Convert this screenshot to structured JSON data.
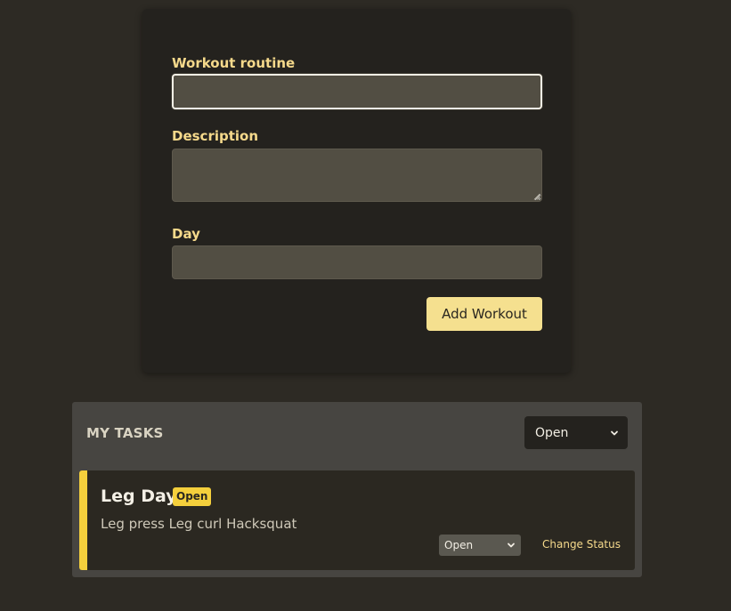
{
  "form": {
    "routine_label": "Workout routine",
    "routine_value": "",
    "description_label": "Description",
    "description_value": "",
    "day_label": "Day",
    "day_value": "",
    "add_button_label": "Add Workout"
  },
  "tasks": {
    "title": "MY TASKS",
    "filter_selected": "Open",
    "items": [
      {
        "name": "Leg Day",
        "status_badge": "Open",
        "description": "Leg press Leg curl Hacksquat",
        "status_selected": "Open",
        "change_status_label": "Change Status"
      }
    ]
  },
  "icons": {
    "select_caret": "chevron-down-icon",
    "textarea_grip": "resize-grip-icon"
  },
  "colors": {
    "background": "#2d2a24",
    "card": "#24221e",
    "accent": "#f4cf3c",
    "label": "#f5d98b",
    "button": "#f5e08f",
    "input": "#524e43",
    "panel": "#474541"
  }
}
